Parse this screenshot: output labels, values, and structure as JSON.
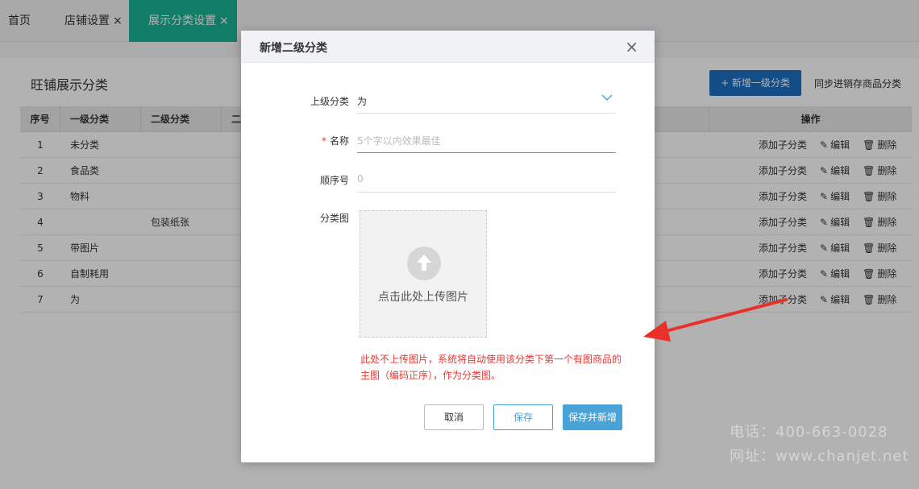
{
  "tabs": [
    {
      "label": "首页",
      "closable": false
    },
    {
      "label": "店铺设置",
      "closable": true
    },
    {
      "label": "展示分类设置",
      "closable": true,
      "active": true
    }
  ],
  "tab_close_glyph": "×",
  "page": {
    "title": "旺铺展示分类",
    "add_primary_label": "+ 新增一级分类",
    "sync_label": "同步进销存商品分类"
  },
  "table": {
    "headers": [
      "序号",
      "一级分类",
      "二级分类",
      "二",
      "操作"
    ],
    "rows": [
      {
        "no": "1",
        "level1": "未分类",
        "level2": ""
      },
      {
        "no": "2",
        "level1": "食品类",
        "level2": ""
      },
      {
        "no": "3",
        "level1": "物料",
        "level2": ""
      },
      {
        "no": "4",
        "level1": "",
        "level2": "包装纸张"
      },
      {
        "no": "5",
        "level1": "带图片",
        "level2": ""
      },
      {
        "no": "6",
        "level1": "自制耗用",
        "level2": ""
      },
      {
        "no": "7",
        "level1": "为",
        "level2": ""
      }
    ],
    "ops": {
      "add_child": "添加子分类",
      "edit": "编辑",
      "delete": "删除"
    }
  },
  "dialog": {
    "title": "新增二级分类",
    "close_glyph": "×",
    "parent_label": "上级分类",
    "parent_value": "为",
    "name_required": "*",
    "name_label": "名称",
    "name_placeholder": "5个字以内效果最佳",
    "order_label": "顺序号",
    "order_placeholder": "0",
    "image_label": "分类图",
    "upload_text": "点击此处上传图片",
    "hint_line1": "此处不上传图片，系统将自动使用该分类下第一个有图商品的",
    "hint_line2": "主图（编码正序），作为分类图。",
    "cancel_label": "取消",
    "save_label": "保存",
    "save_new_label": "保存并新增"
  },
  "watermark": {
    "line1": "电话：400-663-0028",
    "line2": "网址：www.chanjet.net"
  },
  "colors": {
    "tab_active": "#1ab394",
    "primary_button": "#1a6fc2",
    "dialog_accent": "#4aa3d8",
    "hint_red": "#e53935",
    "arrow_red": "#e8312a"
  }
}
